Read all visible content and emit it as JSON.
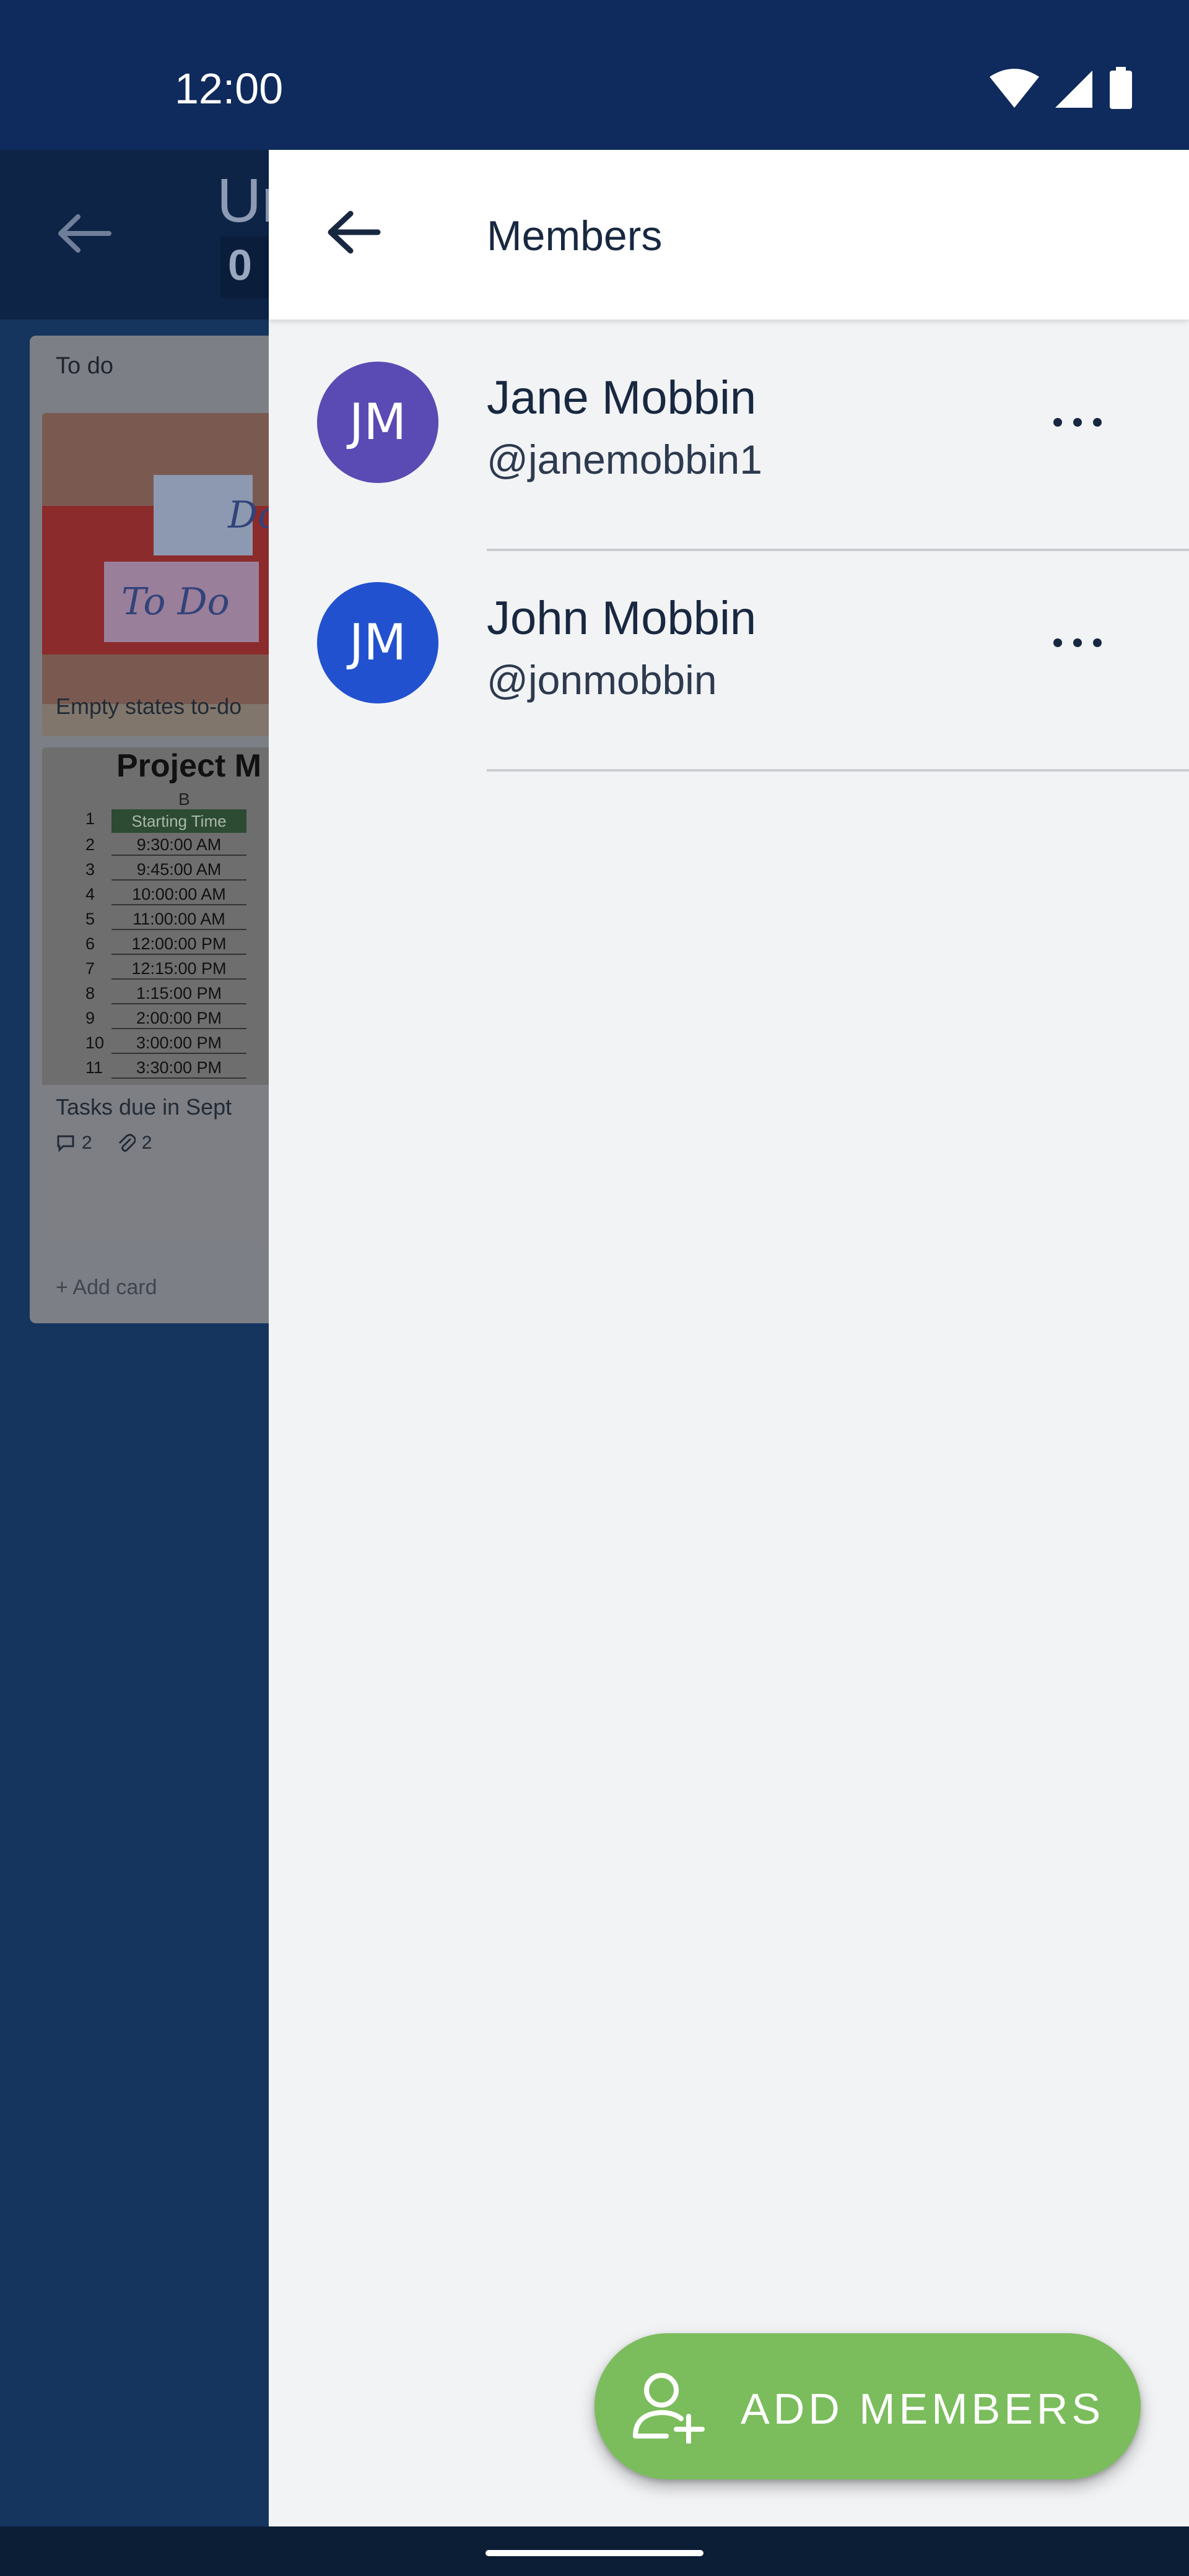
{
  "status_bar": {
    "time": "12:00"
  },
  "board": {
    "title": "Ur",
    "chip": "0",
    "list": {
      "title": "To do",
      "card1": {
        "sticky_doing": "Doin",
        "sticky_todo": "To Do",
        "caption": "Empty states to-do"
      },
      "card2": {
        "sheet_title": "Project M",
        "column_letter": "B",
        "column_header": "Starting Time",
        "rows": [
          {
            "n": "2",
            "v": "9:30:00 AM"
          },
          {
            "n": "3",
            "v": "9:45:00 AM"
          },
          {
            "n": "4",
            "v": "10:00:00 AM"
          },
          {
            "n": "5",
            "v": "11:00:00 AM"
          },
          {
            "n": "6",
            "v": "12:00:00 PM"
          },
          {
            "n": "7",
            "v": "12:15:00 PM"
          },
          {
            "n": "8",
            "v": "1:15:00 PM"
          },
          {
            "n": "9",
            "v": "2:00:00 PM"
          },
          {
            "n": "10",
            "v": "3:00:00 PM"
          },
          {
            "n": "11",
            "v": "3:30:00 PM"
          }
        ],
        "row1_label": "1",
        "caption": "Tasks due in Sept",
        "comments": "2",
        "attachments": "2"
      },
      "add_card": "+ Add card"
    }
  },
  "panel": {
    "title": "Members",
    "members": [
      {
        "initials": "JM",
        "name": "Jane Mobbin",
        "handle": "@janemobbin1",
        "avatar_color": "#5a4ab3"
      },
      {
        "initials": "JM",
        "name": "John Mobbin",
        "handle": "@jonmobbin",
        "avatar_color": "#2251d0"
      }
    ],
    "add_members_label": "ADD MEMBERS"
  }
}
